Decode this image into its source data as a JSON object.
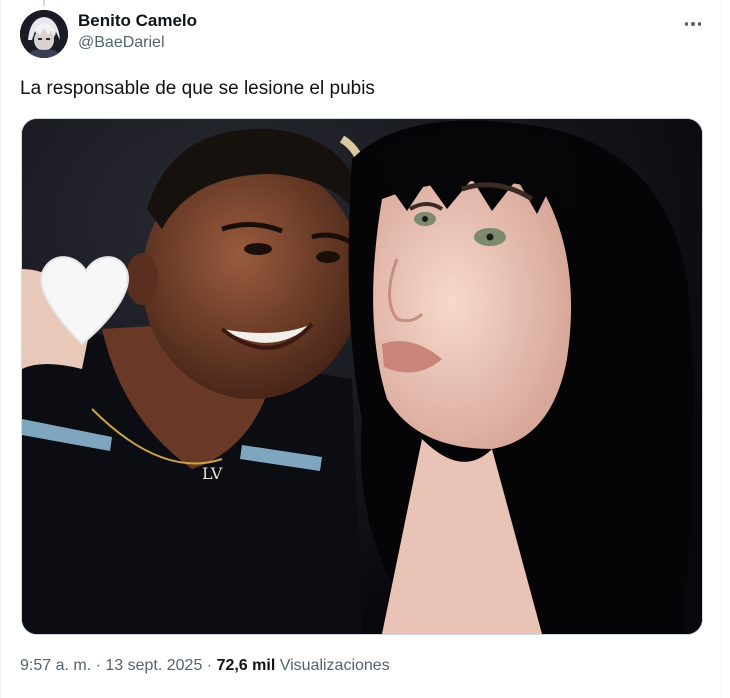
{
  "tweet": {
    "author": {
      "display_name": "Benito Camelo",
      "handle": "@BaeDariel",
      "avatar_icon": "anime-avatar"
    },
    "more_icon": "more-horizontal-icon",
    "text": "La responsable de que se lesione el pubis",
    "media": {
      "description_icon": "photo",
      "sticker_icon": "white-heart-icon"
    },
    "meta": {
      "time": "9:57 a. m.",
      "sep1": " · ",
      "date": "13 sept. 2025",
      "sep2": " · ",
      "views_count": "72,6 mil",
      "views_label": " Visualizaciones"
    }
  },
  "colors": {
    "text_primary": "#0f1419",
    "text_secondary": "#536471",
    "border": "#cfd9de"
  }
}
